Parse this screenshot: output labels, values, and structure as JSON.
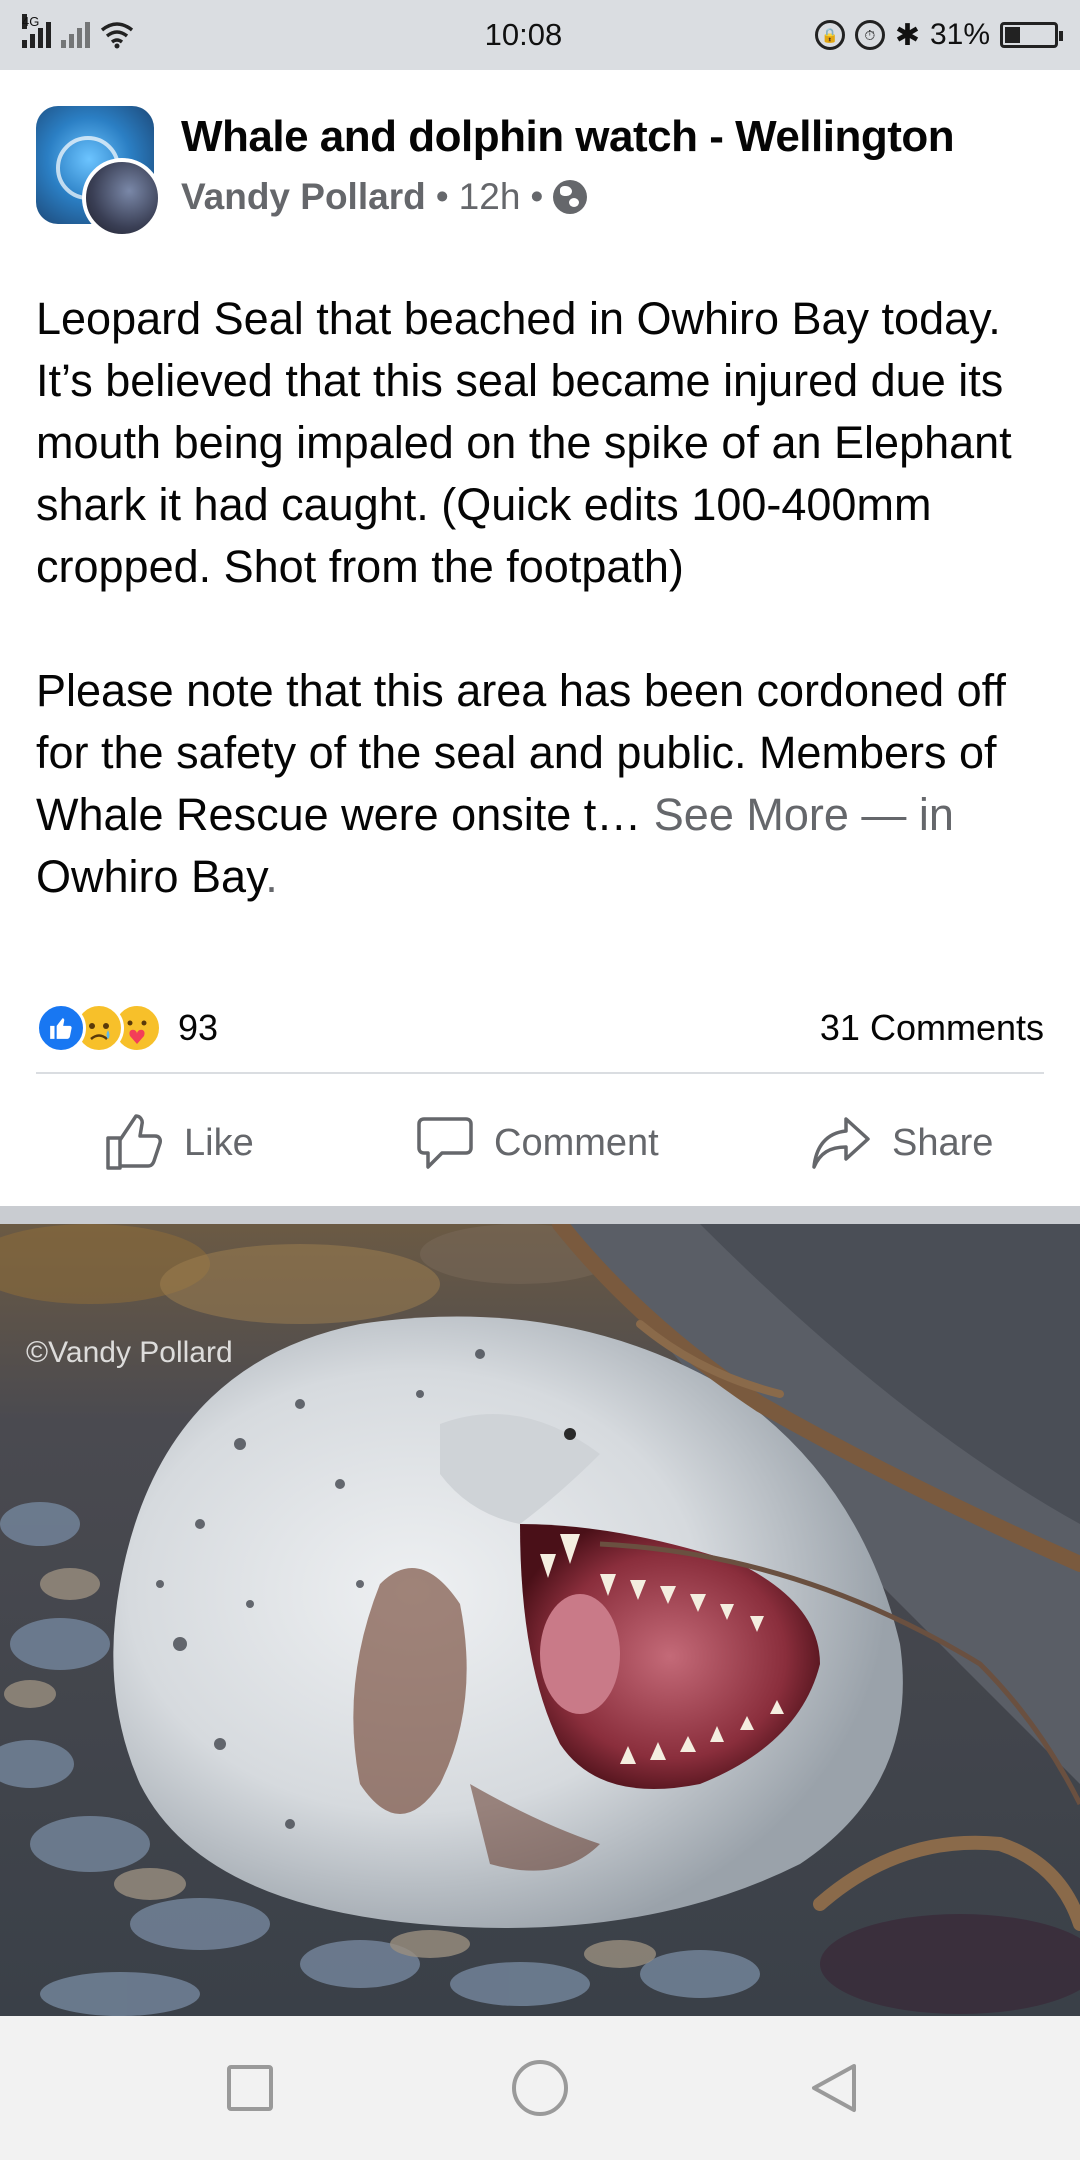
{
  "status_bar": {
    "network_label": "4G",
    "time": "10:08",
    "battery_percent": "31%",
    "battery_level": 0.31
  },
  "post": {
    "group_name": "Whale and dolphin watch - Wellington",
    "author": "Vandy Pollard",
    "separator": "•",
    "time_ago": "12h",
    "body_paragraph_1": "Leopard Seal that beached in Owhiro Bay today. It’s believed that this seal became injured due its mouth being impaled on the spike of an Elephant shark it had caught. (Quick edits 100-400mm cropped. Shot from the footpath)",
    "body_paragraph_2": "Please note that this area has been cordoned off for the safety of the seal and public. Members of Whale Rescue were onsite t…",
    "see_more": "See More",
    "location_prefix": " — in ",
    "location": "Owhiro Bay",
    "location_suffix": "."
  },
  "engagement": {
    "reactions": [
      "like-reaction-icon",
      "sad-reaction-icon",
      "care-reaction-icon"
    ],
    "reaction_count": "93",
    "comments": "31 Comments"
  },
  "actions": {
    "like": "Like",
    "comment": "Comment",
    "share": "Share"
  },
  "photo": {
    "watermark": "©Vandy Pollard"
  },
  "colors": {
    "facebook_blue": "#1877f2",
    "secondary_text": "#65676b",
    "status_bar_bg": "#dadde1"
  }
}
